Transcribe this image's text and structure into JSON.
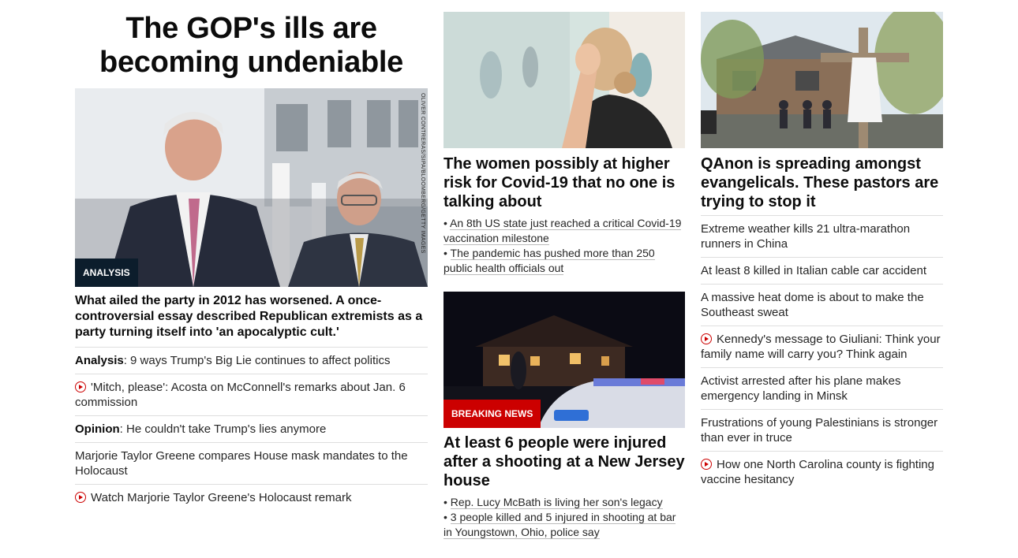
{
  "col1": {
    "headline": "The GOP's ills are becoming undeniable",
    "image_credit": "OLIVER CONTRERAS/SIPA/BLOOMBERG/GETTY IMAGES",
    "tag": "ANALYSIS",
    "caption": "What ailed the party in 2012 has worsened. A once-controversial essay described Republican extremists as a party turning itself into 'an apocalyptic cult.'",
    "links": [
      {
        "prefix": "Analysis",
        "text": ": 9 ways Trump's Big Lie continues to affect politics"
      },
      {
        "text": "'Mitch, please': Acosta on McConnell's remarks about Jan. 6 commission",
        "icon": "play-icon"
      },
      {
        "prefix": "Opinion",
        "text": ": He couldn't take Trump's lies anymore"
      },
      {
        "text": "Marjorie Taylor Greene compares House mask mandates to the Holocaust"
      },
      {
        "text": "Watch Marjorie Taylor Greene's Holocaust remark",
        "icon": "play-icon"
      }
    ]
  },
  "col2": {
    "story1": {
      "headline": "The women possibly at higher risk for Covid-19 that no one is talking about",
      "bullets": [
        "An 8th US state just reached a critical Covid-19 vaccination milestone",
        "The pandemic has pushed more than 250 public health officials out"
      ]
    },
    "story2": {
      "tag": "BREAKING NEWS",
      "headline": "At least 6 people were injured after a shooting at a New Jersey house",
      "bullets": [
        "Rep. Lucy McBath is living her son's legacy",
        "3 people killed and 5 injured in shooting at bar in Youngstown, Ohio, police say"
      ]
    }
  },
  "col3": {
    "headline": "QAnon is spreading amongst evangelicals. These pastors are trying to stop it",
    "links": [
      {
        "text": "Extreme weather kills 21 ultra-marathon runners in China"
      },
      {
        "text": "At least 8 killed in Italian cable car accident"
      },
      {
        "text": "A massive heat dome is about to make the Southeast sweat"
      },
      {
        "text": "Kennedy's message to Giuliani: Think your family name will carry you? Think again",
        "icon": "play-icon"
      },
      {
        "text": "Activist arrested after his plane makes emergency landing in Minsk"
      },
      {
        "text": "Frustrations of young Palestinians is stronger than ever in truce"
      },
      {
        "text": "How one North Carolina county is fighting vaccine hesitancy",
        "icon": "play-icon"
      }
    ]
  },
  "colors": {
    "breaking_red": "#cc0000",
    "analysis_navy": "#0c1d2c",
    "divider": "#dedede",
    "play_icon_red": "#cc0000"
  }
}
